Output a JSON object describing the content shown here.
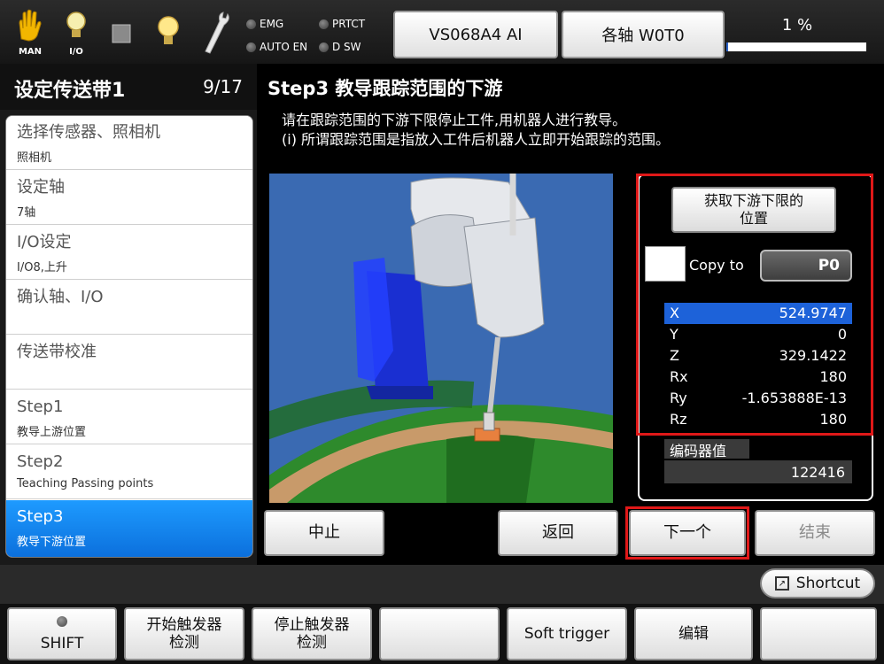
{
  "topbar": {
    "icons": [
      {
        "name": "man-hand-icon",
        "label": "MAN"
      },
      {
        "name": "io-bulb-icon",
        "label": "I/O"
      },
      {
        "name": "stop-square-icon"
      },
      {
        "name": "lamp-icon"
      },
      {
        "name": "wrench-icon"
      }
    ],
    "leds": [
      "EMG",
      "PRTCT",
      "AUTO EN",
      "D SW"
    ],
    "robot_model": "VS068A4 AI",
    "axis_mode": "各轴 W0T0",
    "speed_label": "1 %",
    "speed_percent": 1
  },
  "sidebar": {
    "title": "设定传送带1",
    "counter": "9/17",
    "items": [
      {
        "title": "选择传感器、照相机",
        "sub": "照相机"
      },
      {
        "title": "设定轴",
        "sub": "7轴"
      },
      {
        "title": "I/O设定",
        "sub": "I/O8,上升"
      },
      {
        "title": "确认轴、I/O",
        "sub": ""
      },
      {
        "title": "传送带校准",
        "sub": ""
      },
      {
        "title": "Step1",
        "sub": "教导上游位置"
      },
      {
        "title": "Step2",
        "sub": "Teaching Passing points"
      },
      {
        "title": "Step3",
        "sub": "教导下游位置"
      }
    ],
    "selected_index": 7
  },
  "main": {
    "step_title": "Step3 教导跟踪范围的下游",
    "instruction_1": "请在跟踪范围的下游下限停止工件,用机器人进行教导。",
    "instruction_2": "(i) 所谓跟踪范围是指放入工件后机器人立即开始跟踪的范围。"
  },
  "panel": {
    "get_position_line1": "获取下游下限的",
    "get_position_line2": "位置",
    "copy_to_label": "Copy to",
    "copy_target": "P0",
    "coords": [
      {
        "axis": "X",
        "value": "524.9747"
      },
      {
        "axis": "Y",
        "value": "0"
      },
      {
        "axis": "Z",
        "value": "329.1422"
      },
      {
        "axis": "Rx",
        "value": "180"
      },
      {
        "axis": "Ry",
        "value": "-1.653888E-13"
      },
      {
        "axis": "Rz",
        "value": "180"
      }
    ],
    "encoder_label": "编码器值",
    "encoder_value": "122416"
  },
  "actions": {
    "stop": "中止",
    "back": "返回",
    "next": "下一个",
    "finish": "结束"
  },
  "shortcut_label": "Shortcut",
  "function_keys": {
    "shift": "SHIFT",
    "start_trigger_1": "开始触发器",
    "start_trigger_2": "检测",
    "stop_trigger_1": "停止触发器",
    "stop_trigger_2": "检测",
    "soft_trigger": "Soft trigger",
    "edit": "编辑"
  },
  "colors": {
    "selection_blue": "#0b6fdc",
    "highlight_red": "#e01818",
    "sim_background": "#3a6ab2"
  }
}
